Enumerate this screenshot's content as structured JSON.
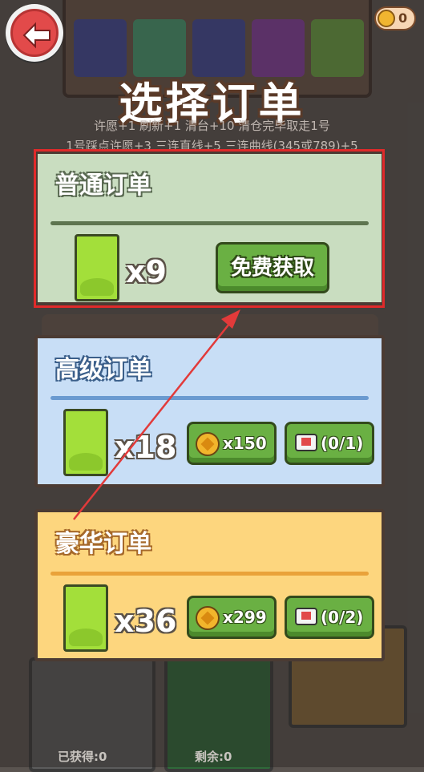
{
  "title": "选择订单",
  "rules": {
    "line1": "许愿+1 刷新+1 清台+10 清仓完毕取走1号",
    "line2": "1号踩点许愿+3 三连直线+5 三连曲线(345或789)+5"
  },
  "top_bar": {
    "coin_count": "0"
  },
  "cards": [
    {
      "title": "普通订单",
      "quantity": "x9",
      "button_label": "免费获取"
    },
    {
      "title": "高级订单",
      "quantity": "x18",
      "coin_cost": "x150",
      "ad_count": "(0/1)"
    },
    {
      "title": "豪华订单",
      "quantity": "x36",
      "coin_cost": "x299",
      "ad_count": "(0/2)"
    }
  ],
  "bottom": {
    "obtained": "已获得:0",
    "remaining": "剩余:0"
  },
  "colors": {
    "normal_bg": "#c9ddc0",
    "advanced_bg": "#c8def6",
    "luxury_bg": "#fdd67e",
    "highlight": "#e02a2a",
    "button_green": "#6ab043"
  }
}
